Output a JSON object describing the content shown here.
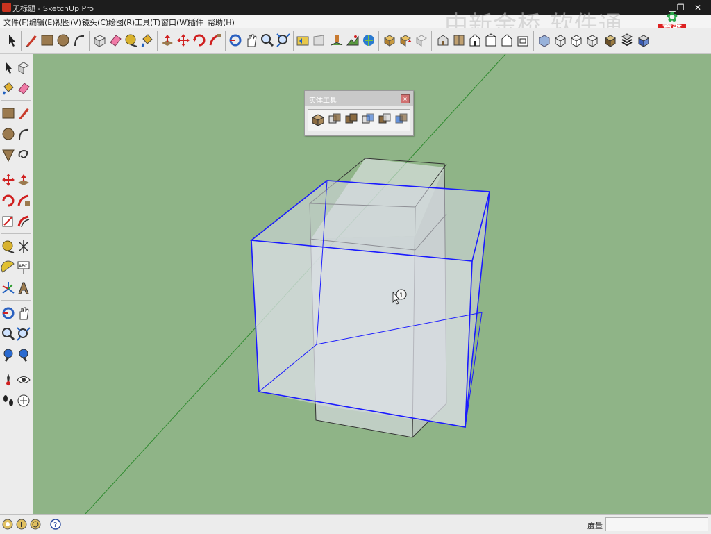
{
  "window": {
    "title": "无标题 - SketchUp Pro",
    "controls": [
      "min-icon",
      "restore-icon",
      "close-icon"
    ]
  },
  "menu": [
    "文件(F)",
    "编辑(E)",
    "视图(V)",
    "镜头(C)",
    "绘图(R)",
    "工具(T)",
    "窗口(W)",
    "插件",
    "帮助(H)"
  ],
  "watermark": "中新金桥 软件通",
  "logo": {
    "line1": "育碟",
    "line2": "软件"
  },
  "toolbar_icons": [
    "select-icon",
    "pencil-icon",
    "rectangle-icon",
    "circle-icon",
    "arc-icon",
    "make-component-icon",
    "eraser-icon",
    "tape-measure-icon",
    "paint-bucket-icon",
    "push-pull-icon",
    "move-icon",
    "rotate-icon",
    "follow-me-icon",
    "orbit-icon",
    "pan-icon",
    "zoom-icon",
    "zoom-extents-icon",
    "previous-view-icon",
    "next-view-icon",
    "add-location-icon",
    "toggle-terrain-icon",
    "photo-texture-icon",
    "get-models-icon",
    "share-model-icon",
    "share-component-icon",
    "iso-view-icon",
    "top-view-icon",
    "front-view-icon",
    "right-view-icon",
    "back-view-icon",
    "left-view-icon",
    "xray-style-icon",
    "wireframe-style-icon",
    "hidden-line-style-icon",
    "shaded-style-icon",
    "shaded-texture-style-icon",
    "monochrome-style-icon"
  ],
  "left_tools": [
    [
      "select-icon",
      "make-component-icon"
    ],
    [
      "paint-bucket-icon",
      "eraser-icon"
    ],
    [
      "rectangle-icon",
      "line-icon"
    ],
    [
      "circle-icon",
      "arc-icon"
    ],
    [
      "polygon-icon",
      "freehand-icon"
    ],
    [
      "move-icon",
      "push-pull-icon"
    ],
    [
      "rotate-icon",
      "follow-me-icon"
    ],
    [
      "scale-icon",
      "offset-icon"
    ],
    [
      "tape-measure-icon",
      "dimension-icon"
    ],
    [
      "protractor-icon",
      "text-icon"
    ],
    [
      "axes-icon",
      "3d-text-icon"
    ],
    [
      "orbit-icon",
      "pan-icon"
    ],
    [
      "zoom-icon",
      "zoom-window-icon"
    ],
    [
      "previous-view-icon",
      "zoom-extents-icon"
    ],
    [
      "position-camera-icon",
      "look-around-icon"
    ],
    [
      "walk-icon",
      "section-plane-icon"
    ]
  ],
  "palette": {
    "title": "实体工具",
    "buttons": [
      "outer-shell-icon",
      "intersect-icon",
      "union-icon",
      "subtract-icon",
      "trim-icon",
      "split-icon"
    ]
  },
  "cursor": {
    "tool": "select-icon",
    "badge": "1"
  },
  "status": {
    "icons": [
      "geo-location-icon",
      "credits-icon",
      "sign-in-icon",
      "help-icon"
    ],
    "measure_label": "度量",
    "measure_value": ""
  },
  "colors": {
    "background": "#8fb487",
    "selection": "#1a1aff",
    "axis_green": "#2f8a2f",
    "titlebar": "#1d1d1d"
  }
}
